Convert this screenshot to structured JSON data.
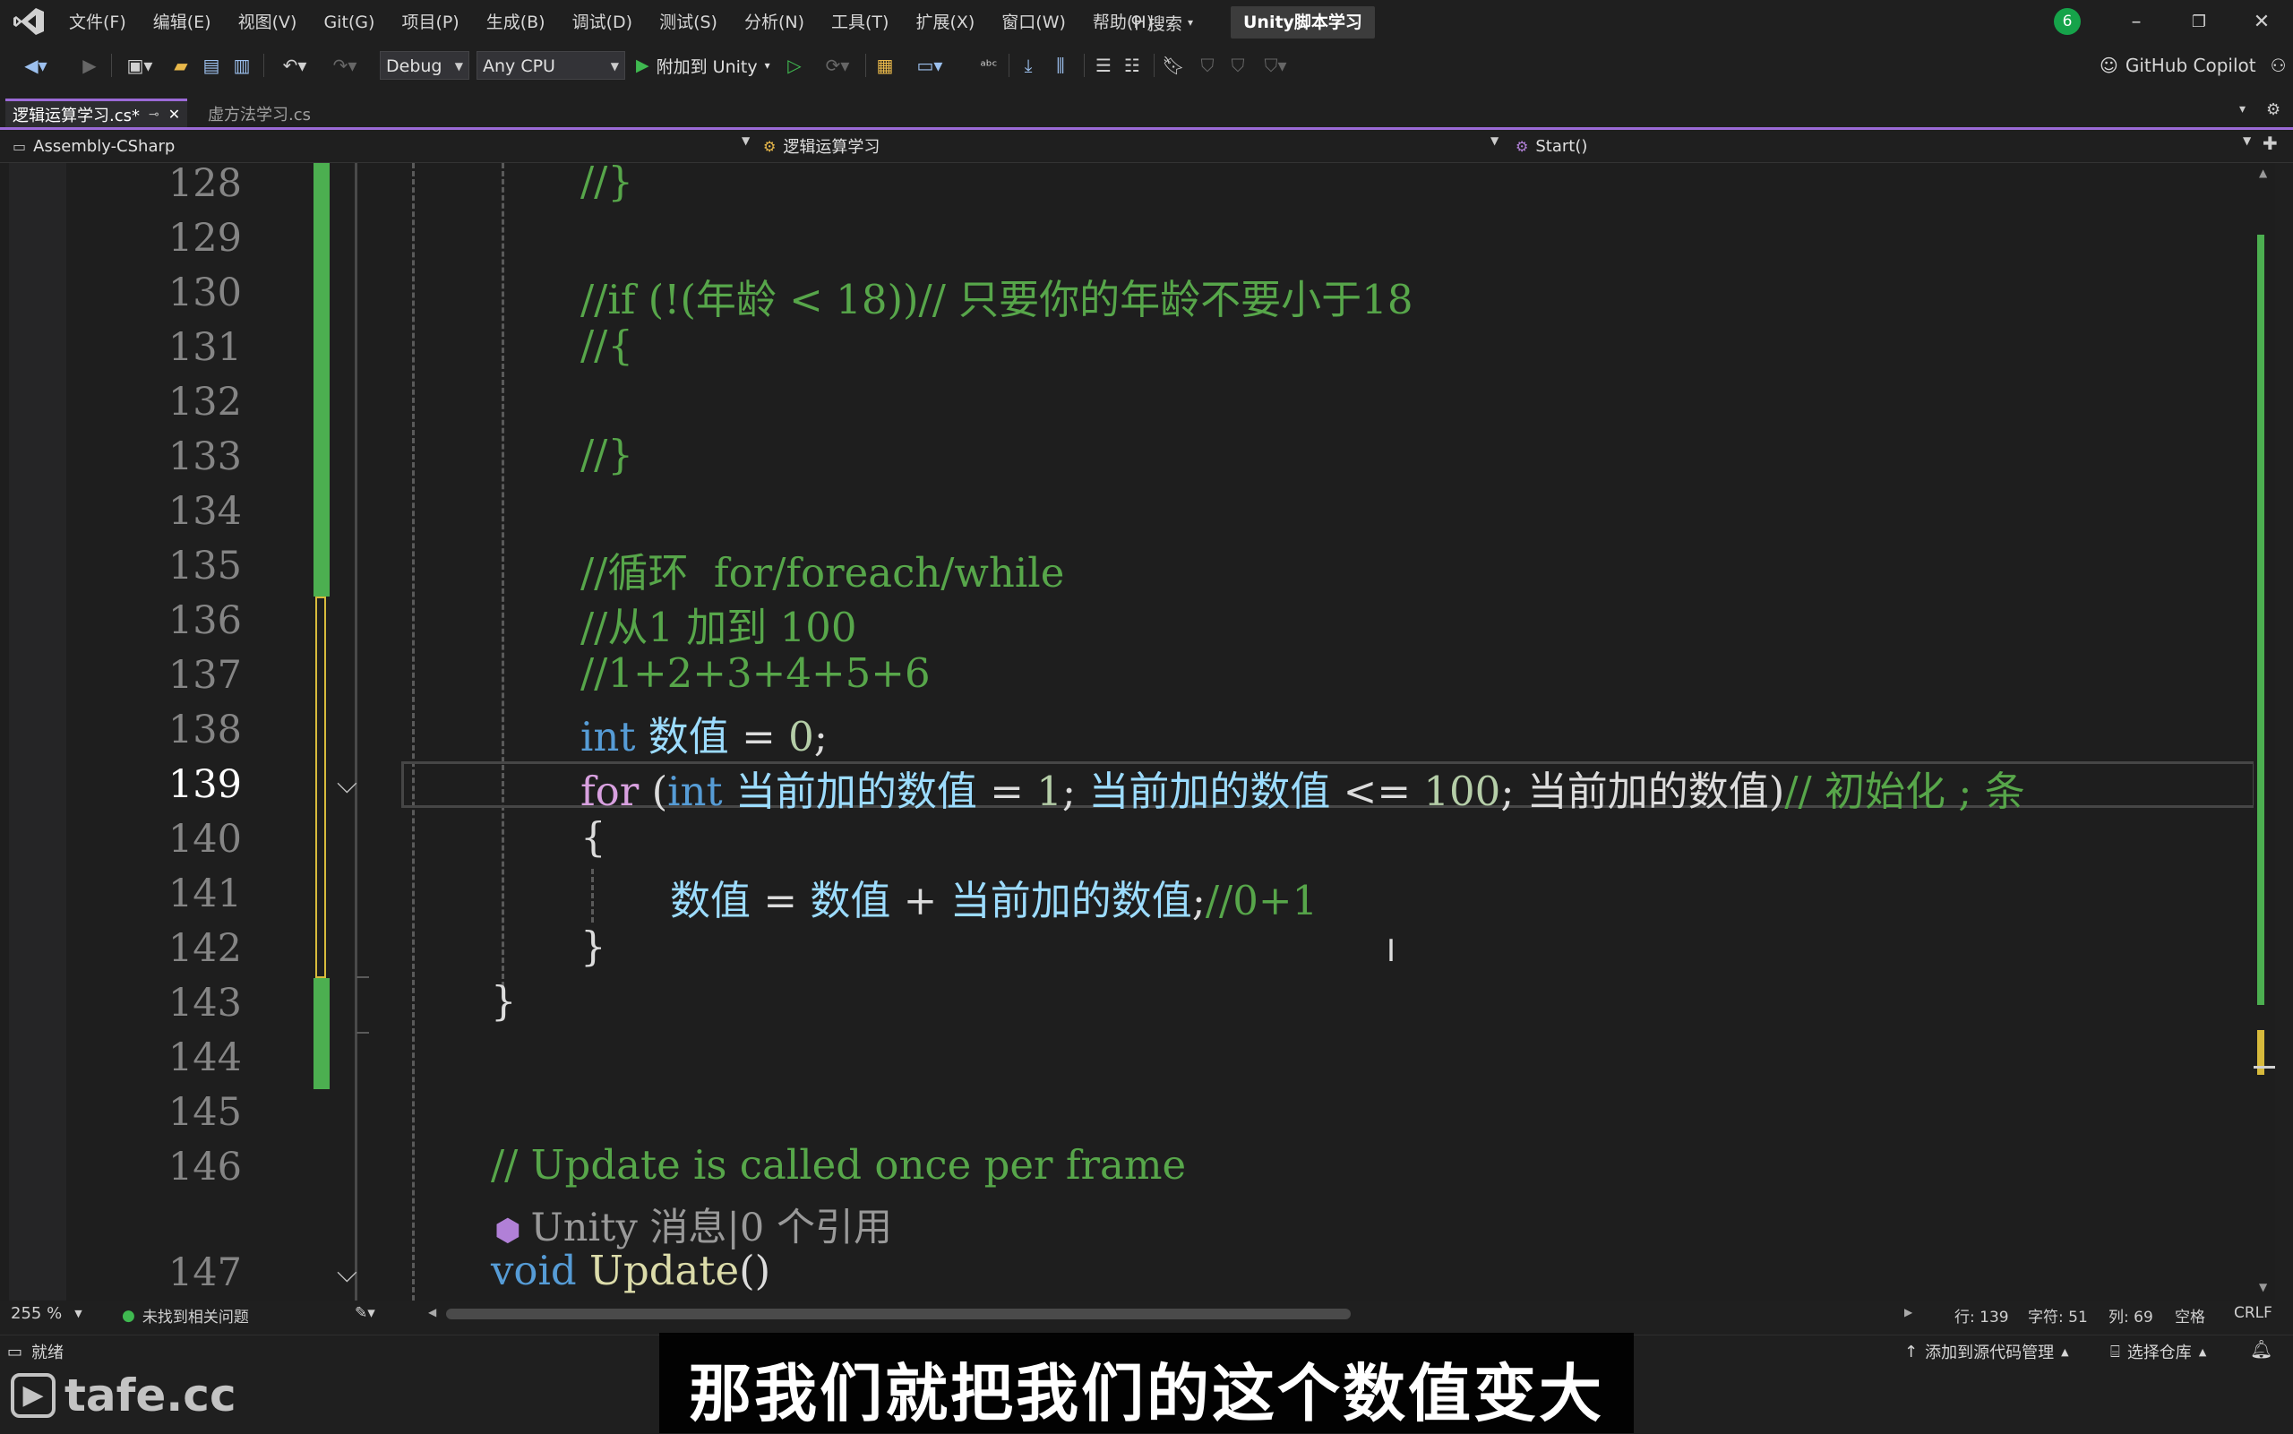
{
  "menu": [
    "文件(F)",
    "编辑(E)",
    "视图(V)",
    "Git(G)",
    "项目(P)",
    "生成(B)",
    "调试(D)",
    "测试(S)",
    "分析(N)",
    "工具(T)",
    "扩展(X)",
    "窗口(W)",
    "帮助(H)"
  ],
  "search_label": "搜索",
  "solution_name": "Unity脚本学习",
  "notification_count": "6",
  "toolbar": {
    "config": "Debug",
    "platform": "Any CPU",
    "attach_label": "附加到 Unity",
    "copilot_label": "GitHub Copilot"
  },
  "tabs": {
    "active": "逻辑运算学习.cs*",
    "inactive": "虚方法学习.cs"
  },
  "navbar": {
    "project": "Assembly-CSharp",
    "class": "逻辑运算学习",
    "member": "Start()"
  },
  "editor": {
    "line_numbers": [
      "128",
      "129",
      "130",
      "131",
      "132",
      "133",
      "134",
      "135",
      "136",
      "137",
      "138",
      "139",
      "140",
      "141",
      "142",
      "143",
      "144",
      "145",
      "146",
      "147"
    ],
    "current_line": "139",
    "lines": {
      "l128": "//}",
      "l130": "//if (!(年龄 < 18))// 只要你的年龄不要小于18",
      "l131": "//{",
      "l133": "//}",
      "l135": "//循环  for/foreach/while",
      "l136": "//从1 加到 100",
      "l137": "//1+2+3+4+5+6",
      "l138_kw": "int",
      "l138_id": " 数值",
      "l138_rest": " = ",
      "l138_num": "0",
      "l138_end": ";",
      "l139_for": "for",
      "l139_p1": " (",
      "l139_int": "int",
      "l139_v1": " 当前加的数值",
      "l139_eq": " = ",
      "l139_n1": "1",
      "l139_s1": "; ",
      "l139_v2": "当前加的数值",
      "l139_le": " <= ",
      "l139_n2": "100",
      "l139_s2": "; ",
      "l139_v3": "当前加的数值",
      "l139_close": ")",
      "l139_cm": "// 初始化 ; 条",
      "l140": "{",
      "l141_a": "数值",
      "l141_b": " = ",
      "l141_c": "数值",
      "l141_d": " + ",
      "l141_e": "当前加的数值",
      "l141_f": ";",
      "l141_cm": "//0+1",
      "l142": "}",
      "l143": "}",
      "l146": "// Update is called once per frame",
      "l147_kw": "void",
      "l147_fn": " Update",
      "l147_rest": "()"
    },
    "codelens": "Unity 消息|0 个引用"
  },
  "editor_status": {
    "zoom": "255 %",
    "issues": "未找到相关问题",
    "line": "行: 139",
    "char": "字符: 51",
    "col": "列: 69",
    "spaces": "空格",
    "eol": "CRLF"
  },
  "statusbar": {
    "ready": "就绪",
    "add_source": "添加到源代码管理",
    "select_repo": "选择仓库"
  },
  "subtitle": "那我们就把我们的这个数值变大",
  "watermark": "tafe.cc",
  "colors": {
    "accent": "#9b6ad7",
    "comment": "#57a64a",
    "keyword": "#569cd6",
    "identifier": "#9cdcfe",
    "number": "#b5cea8",
    "change_saved": "#4caf50",
    "change_unsaved": "#d7ba3c"
  }
}
